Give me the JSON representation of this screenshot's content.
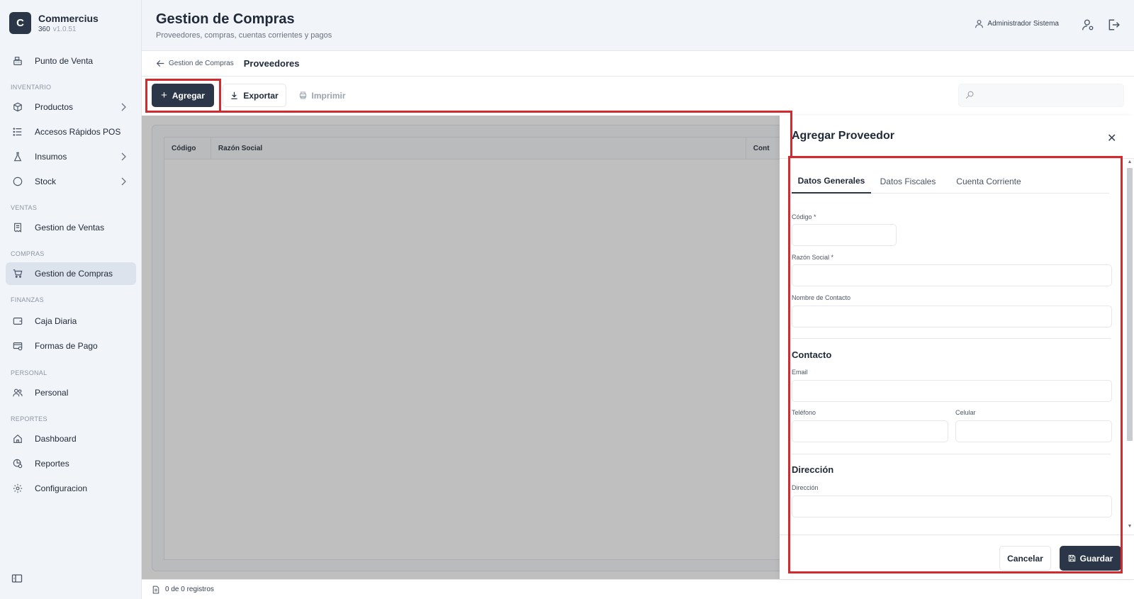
{
  "brand": {
    "letter": "C",
    "name": "Commercius",
    "sub": "360",
    "version": "v1.0.51"
  },
  "sidebar": {
    "sections": [
      "INVENTARIO",
      "VENTAS",
      "COMPRAS",
      "FINANZAS",
      "PERSONAL",
      "REPORTES"
    ],
    "items": [
      {
        "label": "Punto de Venta",
        "icon": "cash-register-icon"
      },
      {
        "label": "Productos",
        "icon": "box-icon"
      },
      {
        "label": "Accesos Rápidos POS",
        "icon": "list-icon"
      },
      {
        "label": "Insumos",
        "icon": "flask-icon"
      },
      {
        "label": "Stock",
        "icon": "circle-icon"
      },
      {
        "label": "Gestion de Ventas",
        "icon": "receipt-icon"
      },
      {
        "label": "Gestion de Compras",
        "icon": "cart-icon"
      },
      {
        "label": "Caja Diaria",
        "icon": "wallet-icon"
      },
      {
        "label": "Formas de Pago",
        "icon": "payment-icon"
      },
      {
        "label": "Personal",
        "icon": "users-icon"
      },
      {
        "label": "Dashboard",
        "icon": "home-icon"
      },
      {
        "label": "Reportes",
        "icon": "reports-icon"
      },
      {
        "label": "Configuracion",
        "icon": "gear-icon"
      }
    ]
  },
  "header": {
    "title": "Gestion de Compras",
    "subtitle": "Proveedores, compras, cuentas corrientes y pagos",
    "user": "Administrador Sistema"
  },
  "breadcrumb": {
    "back": "Gestion de Compras",
    "current": "Proveedores"
  },
  "toolbar": {
    "add": "Agregar",
    "export": "Exportar",
    "print": "Imprimir",
    "search_placeholder": ""
  },
  "table": {
    "columns": [
      "Código",
      "Razón Social",
      "Cont"
    ]
  },
  "footer": {
    "records": "0 de 0 registros"
  },
  "drawer": {
    "title": "Agregar Proveedor",
    "tabs": [
      "Datos Generales",
      "Datos Fiscales",
      "Cuenta Corriente"
    ],
    "fields": {
      "codigo": "Código *",
      "razon_social": "Razón Social *",
      "nombre_contacto": "Nombre de Contacto",
      "email": "Email",
      "telefono": "Teléfono",
      "celular": "Celular",
      "direccion": "Dirección"
    },
    "sections": {
      "contacto": "Contacto",
      "direccion": "Dirección"
    },
    "cancel": "Cancelar",
    "save": "Guardar"
  },
  "colors": {
    "primary": "#2b3648",
    "highlight": "#d22a2f",
    "sidebar_bg": "#f1f4f8"
  }
}
